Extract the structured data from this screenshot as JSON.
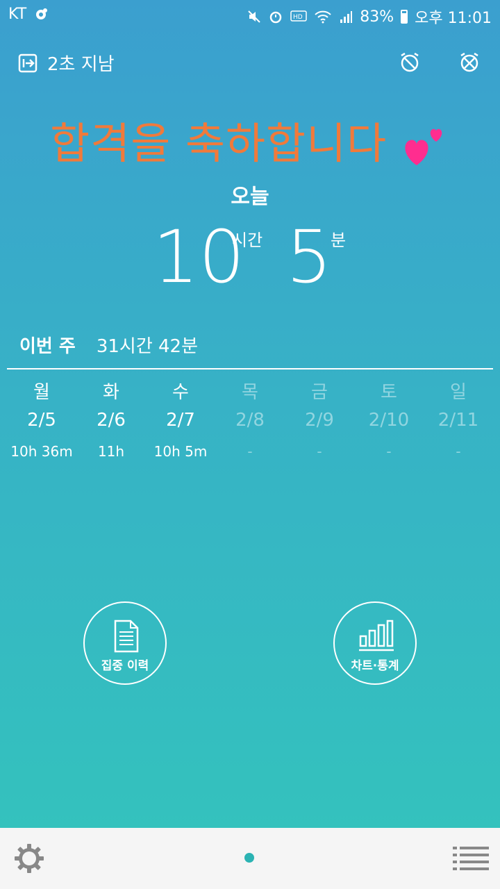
{
  "status_bar": {
    "carrier": "KT",
    "battery": "83%",
    "time": "오후 11:01"
  },
  "header": {
    "elapsed": "2초 지남"
  },
  "congrats": "합격을 축하합니다",
  "today": {
    "label": "오늘",
    "hours": "10",
    "hours_unit": "시간",
    "minutes": "5",
    "minutes_unit": "분"
  },
  "week": {
    "label": "이번 주",
    "total": "31시간 42분"
  },
  "days": [
    {
      "name": "월",
      "date": "2/5",
      "time": "10h 36m"
    },
    {
      "name": "화",
      "date": "2/6",
      "time": "11h"
    },
    {
      "name": "수",
      "date": "2/7",
      "time": "10h 5m"
    },
    {
      "name": "목",
      "date": "2/8",
      "time": "-"
    },
    {
      "name": "금",
      "date": "2/9",
      "time": "-"
    },
    {
      "name": "토",
      "date": "2/10",
      "time": "-"
    },
    {
      "name": "일",
      "date": "2/11",
      "time": "-"
    }
  ],
  "buttons": {
    "history": "집중 이력",
    "chart": "차트·통계"
  },
  "colors": {
    "accent": "#f07a3b",
    "bg_top": "#3b9fcf",
    "bg_bottom": "#33c4bc",
    "pager": "#2bb3b3"
  }
}
